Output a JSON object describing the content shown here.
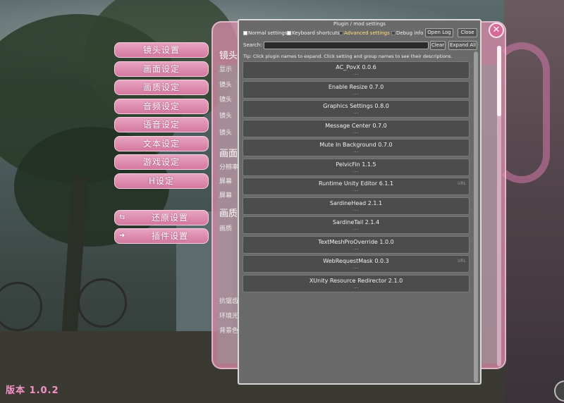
{
  "window": {
    "title": "Plugin / mod settings",
    "toggles": [
      {
        "label": "Normal settings",
        "checked": true,
        "active": false
      },
      {
        "label": "Keyboard shortcuts",
        "checked": true,
        "active": false
      },
      {
        "label": "Advanced settings",
        "checked": false,
        "active": true
      },
      {
        "label": "Debug info",
        "checked": false,
        "active": false
      }
    ],
    "open_log_label": "Open Log",
    "close_label": "Close",
    "search_label": "Search:",
    "search_value": "",
    "clear_label": "Clear",
    "expand_all_label": "Expand All",
    "tip": "Tip: Click plugin names to expand. Click setting and group names to see their descriptions.",
    "plugins": [
      {
        "name": "AC_PovX 0.0.6",
        "more": "...",
        "url": ""
      },
      {
        "name": "Enable Resize 0.7.0",
        "more": "...",
        "url": ""
      },
      {
        "name": "Graphics Settings 0.8.0",
        "more": "...",
        "url": ""
      },
      {
        "name": "Message Center 0.7.0",
        "more": "...",
        "url": ""
      },
      {
        "name": "Mute In Background 0.7.0",
        "more": "...",
        "url": ""
      },
      {
        "name": "PelvicFin 1.1.5",
        "more": "...",
        "url": ""
      },
      {
        "name": "Runtime Unity Editor 6.1.1",
        "more": "...",
        "url": "URL"
      },
      {
        "name": "SardineHead 2.1.1",
        "more": "...",
        "url": ""
      },
      {
        "name": "SardineTail 2.1.4",
        "more": "...",
        "url": ""
      },
      {
        "name": "TextMeshProOverride 1.0.0",
        "more": "...",
        "url": ""
      },
      {
        "name": "WebRequestMask 0.0.3",
        "more": "...",
        "url": "URL"
      },
      {
        "name": "XUnity Resource Redirector 2.1.0",
        "more": "...",
        "url": ""
      }
    ]
  },
  "game_menu": {
    "items": [
      "镜头设置",
      "画面设定",
      "画质设定",
      "音频设定",
      "语音设定",
      "文本设定",
      "游戏设定",
      "H设定"
    ],
    "reset_label": "还原设置",
    "plugin_label": "插件设置",
    "version": "版本 1.0.2"
  },
  "game_panel": {
    "heading_1": "镜头",
    "labels_1": [
      "显示",
      "镜头",
      "镜头",
      "镜头",
      "镜头"
    ],
    "heading_2": "画面",
    "labels_2": [
      "分辨率",
      "屏幕",
      "屏幕"
    ],
    "heading_3": "画质",
    "labels_3": [
      "画质"
    ],
    "labels_4": [
      "抗锯齿",
      "环境光",
      "背景色"
    ]
  },
  "colors": {
    "accent_pink": "#d4789f",
    "active_toggle": "#ffe27a",
    "window_bg": "#6a6a6a"
  }
}
